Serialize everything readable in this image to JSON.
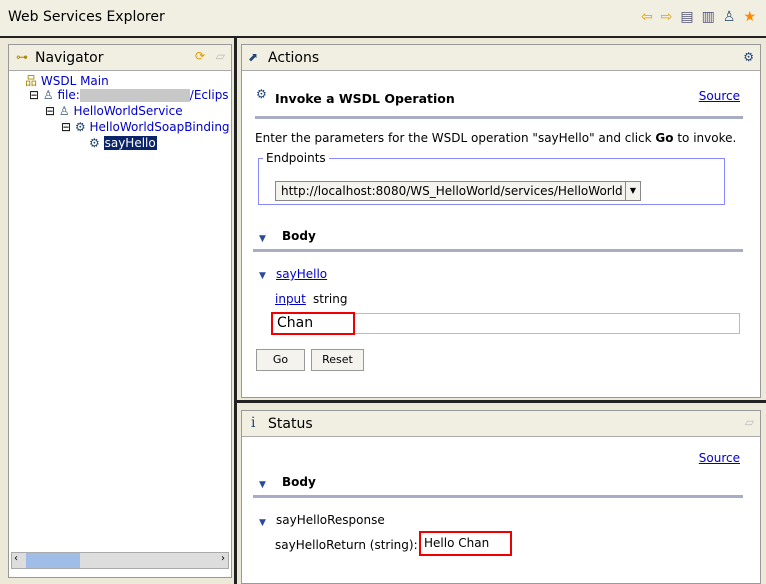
{
  "window": {
    "title": "Web Services Explorer",
    "toolbar_icons": [
      "back-icon",
      "forward-icon",
      "wsdl-page-icon",
      "uddi-page-icon",
      "wsil-page-icon",
      "favorites-icon"
    ]
  },
  "navigator": {
    "title": "Navigator",
    "tree": [
      {
        "label": "WSDL Main"
      },
      {
        "label": "file:",
        "suffix": "/Eclips"
      },
      {
        "label": "HelloWorldService"
      },
      {
        "label": "HelloWorldSoapBinding"
      },
      {
        "label": "sayHello",
        "selected": true
      }
    ]
  },
  "actions": {
    "title": "Actions",
    "heading": "Invoke a WSDL Operation",
    "source_link": "Source",
    "instructions_pre": "Enter the parameters for the WSDL operation \"sayHello\" and click ",
    "instructions_bold": "Go",
    "instructions_post": " to invoke.",
    "endpoints_legend": "Endpoints",
    "endpoint_value": "http://localhost:8080/WS_HelloWorld/services/HelloWorld",
    "body_label": "Body",
    "operation_link": "sayHello",
    "param_link": "input",
    "param_type": "string",
    "param_value": "Chan",
    "go_button": "Go",
    "reset_button": "Reset"
  },
  "status": {
    "title": "Status",
    "source_link": "Source",
    "body_label": "Body",
    "response_label": "sayHelloResponse",
    "return_label": "sayHelloReturn (string):",
    "return_value": "Hello Chan"
  }
}
